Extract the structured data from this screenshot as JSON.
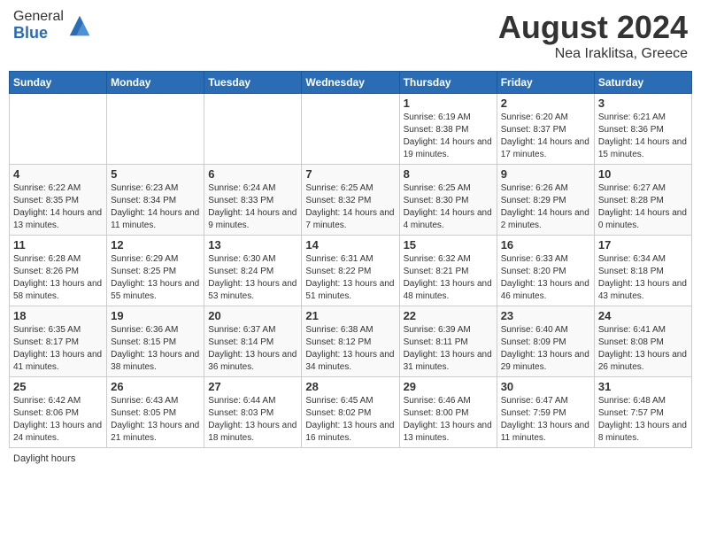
{
  "header": {
    "logo_general": "General",
    "logo_blue": "Blue",
    "title": "August 2024",
    "subtitle": "Nea Iraklitsa, Greece"
  },
  "days_of_week": [
    "Sunday",
    "Monday",
    "Tuesday",
    "Wednesday",
    "Thursday",
    "Friday",
    "Saturday"
  ],
  "weeks": [
    [
      {
        "day": "",
        "info": ""
      },
      {
        "day": "",
        "info": ""
      },
      {
        "day": "",
        "info": ""
      },
      {
        "day": "",
        "info": ""
      },
      {
        "day": "1",
        "info": "Sunrise: 6:19 AM\nSunset: 8:38 PM\nDaylight: 14 hours and 19 minutes."
      },
      {
        "day": "2",
        "info": "Sunrise: 6:20 AM\nSunset: 8:37 PM\nDaylight: 14 hours and 17 minutes."
      },
      {
        "day": "3",
        "info": "Sunrise: 6:21 AM\nSunset: 8:36 PM\nDaylight: 14 hours and 15 minutes."
      }
    ],
    [
      {
        "day": "4",
        "info": "Sunrise: 6:22 AM\nSunset: 8:35 PM\nDaylight: 14 hours and 13 minutes."
      },
      {
        "day": "5",
        "info": "Sunrise: 6:23 AM\nSunset: 8:34 PM\nDaylight: 14 hours and 11 minutes."
      },
      {
        "day": "6",
        "info": "Sunrise: 6:24 AM\nSunset: 8:33 PM\nDaylight: 14 hours and 9 minutes."
      },
      {
        "day": "7",
        "info": "Sunrise: 6:25 AM\nSunset: 8:32 PM\nDaylight: 14 hours and 7 minutes."
      },
      {
        "day": "8",
        "info": "Sunrise: 6:25 AM\nSunset: 8:30 PM\nDaylight: 14 hours and 4 minutes."
      },
      {
        "day": "9",
        "info": "Sunrise: 6:26 AM\nSunset: 8:29 PM\nDaylight: 14 hours and 2 minutes."
      },
      {
        "day": "10",
        "info": "Sunrise: 6:27 AM\nSunset: 8:28 PM\nDaylight: 14 hours and 0 minutes."
      }
    ],
    [
      {
        "day": "11",
        "info": "Sunrise: 6:28 AM\nSunset: 8:26 PM\nDaylight: 13 hours and 58 minutes."
      },
      {
        "day": "12",
        "info": "Sunrise: 6:29 AM\nSunset: 8:25 PM\nDaylight: 13 hours and 55 minutes."
      },
      {
        "day": "13",
        "info": "Sunrise: 6:30 AM\nSunset: 8:24 PM\nDaylight: 13 hours and 53 minutes."
      },
      {
        "day": "14",
        "info": "Sunrise: 6:31 AM\nSunset: 8:22 PM\nDaylight: 13 hours and 51 minutes."
      },
      {
        "day": "15",
        "info": "Sunrise: 6:32 AM\nSunset: 8:21 PM\nDaylight: 13 hours and 48 minutes."
      },
      {
        "day": "16",
        "info": "Sunrise: 6:33 AM\nSunset: 8:20 PM\nDaylight: 13 hours and 46 minutes."
      },
      {
        "day": "17",
        "info": "Sunrise: 6:34 AM\nSunset: 8:18 PM\nDaylight: 13 hours and 43 minutes."
      }
    ],
    [
      {
        "day": "18",
        "info": "Sunrise: 6:35 AM\nSunset: 8:17 PM\nDaylight: 13 hours and 41 minutes."
      },
      {
        "day": "19",
        "info": "Sunrise: 6:36 AM\nSunset: 8:15 PM\nDaylight: 13 hours and 38 minutes."
      },
      {
        "day": "20",
        "info": "Sunrise: 6:37 AM\nSunset: 8:14 PM\nDaylight: 13 hours and 36 minutes."
      },
      {
        "day": "21",
        "info": "Sunrise: 6:38 AM\nSunset: 8:12 PM\nDaylight: 13 hours and 34 minutes."
      },
      {
        "day": "22",
        "info": "Sunrise: 6:39 AM\nSunset: 8:11 PM\nDaylight: 13 hours and 31 minutes."
      },
      {
        "day": "23",
        "info": "Sunrise: 6:40 AM\nSunset: 8:09 PM\nDaylight: 13 hours and 29 minutes."
      },
      {
        "day": "24",
        "info": "Sunrise: 6:41 AM\nSunset: 8:08 PM\nDaylight: 13 hours and 26 minutes."
      }
    ],
    [
      {
        "day": "25",
        "info": "Sunrise: 6:42 AM\nSunset: 8:06 PM\nDaylight: 13 hours and 24 minutes."
      },
      {
        "day": "26",
        "info": "Sunrise: 6:43 AM\nSunset: 8:05 PM\nDaylight: 13 hours and 21 minutes."
      },
      {
        "day": "27",
        "info": "Sunrise: 6:44 AM\nSunset: 8:03 PM\nDaylight: 13 hours and 18 minutes."
      },
      {
        "day": "28",
        "info": "Sunrise: 6:45 AM\nSunset: 8:02 PM\nDaylight: 13 hours and 16 minutes."
      },
      {
        "day": "29",
        "info": "Sunrise: 6:46 AM\nSunset: 8:00 PM\nDaylight: 13 hours and 13 minutes."
      },
      {
        "day": "30",
        "info": "Sunrise: 6:47 AM\nSunset: 7:59 PM\nDaylight: 13 hours and 11 minutes."
      },
      {
        "day": "31",
        "info": "Sunrise: 6:48 AM\nSunset: 7:57 PM\nDaylight: 13 hours and 8 minutes."
      }
    ]
  ],
  "footer": "Daylight hours"
}
